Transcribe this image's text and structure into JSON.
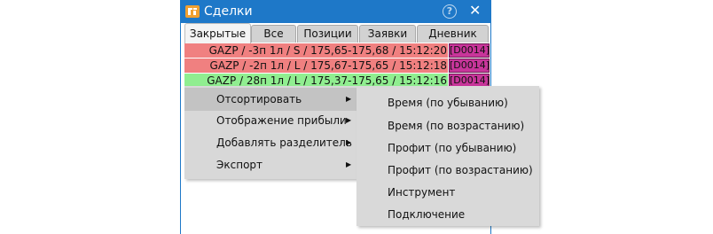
{
  "window": {
    "title": "Сделки",
    "help_label": "?",
    "close_label": "✕"
  },
  "colors": {
    "titlebar": "#1e78c8",
    "short_row": "#f08080",
    "long_row": "#90ee90",
    "tag": "#c8359a"
  },
  "tabs": [
    {
      "label": "Закрытые",
      "active": true
    },
    {
      "label": "Все",
      "active": false
    },
    {
      "label": "Позиции",
      "active": false
    },
    {
      "label": "Заявки",
      "active": false
    },
    {
      "label": "Дневник",
      "active": false
    }
  ],
  "deals": [
    {
      "text": "GAZP / -3п 1л / S / 175,65-175,68 / 15:12:20",
      "tag": "[D0014]",
      "side": "short"
    },
    {
      "text": "GAZP / -2п 1л / L / 175,67-175,65 / 15:12:18",
      "tag": "[D0014]",
      "side": "short"
    },
    {
      "text": "GAZP / 28п 1л / L / 175,37-175,65 / 15:12:16",
      "tag": "[D0014]",
      "side": "long"
    }
  ],
  "context_menu": {
    "items": [
      {
        "label": "Отсортировать",
        "arrow": "▶"
      },
      {
        "label": "Отображение прибыли",
        "arrow": "▶"
      },
      {
        "label": "Добавлять разделитель",
        "arrow": "▶"
      },
      {
        "label": "Экспорт",
        "arrow": "▶"
      }
    ]
  },
  "submenu": {
    "items": [
      {
        "label": "Время (по убыванию)"
      },
      {
        "label": "Время (по возрастанию)"
      },
      {
        "label": "Профит (по убыванию)"
      },
      {
        "label": "Профит (по возрастанию)"
      },
      {
        "label": "Инструмент"
      },
      {
        "label": "Подключение"
      }
    ]
  }
}
